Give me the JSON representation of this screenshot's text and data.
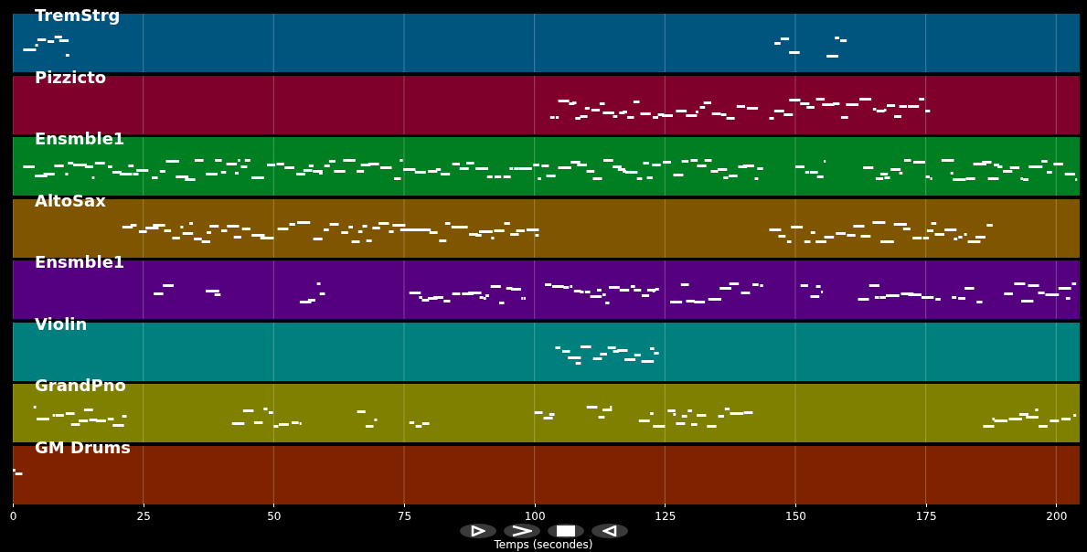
{
  "tracks": [
    {
      "name": "TremStrg",
      "color": "#00557f"
    },
    {
      "name": "Pizzicto",
      "color": "#7f002a"
    },
    {
      "name": "Ensmble1",
      "color": "#007f22"
    },
    {
      "name": "AltoSax",
      "color": "#7f5500"
    },
    {
      "name": "Ensmble1",
      "color": "#55007f"
    },
    {
      "name": "Violin",
      "color": "#007f7f"
    },
    {
      "name": "GrandPno",
      "color": "#7f7f00"
    },
    {
      "name": "GM Drums",
      "color": "#7f2200"
    }
  ],
  "x_axis": {
    "label": "Temps (secondes)",
    "ticks": [
      "0",
      "25",
      "50",
      "75",
      "100",
      "125",
      "150",
      "175",
      "200"
    ]
  },
  "toolbar": [
    {
      "kind": "play"
    },
    {
      "kind": "forward"
    },
    {
      "kind": "stop"
    },
    {
      "kind": "back"
    }
  ]
}
